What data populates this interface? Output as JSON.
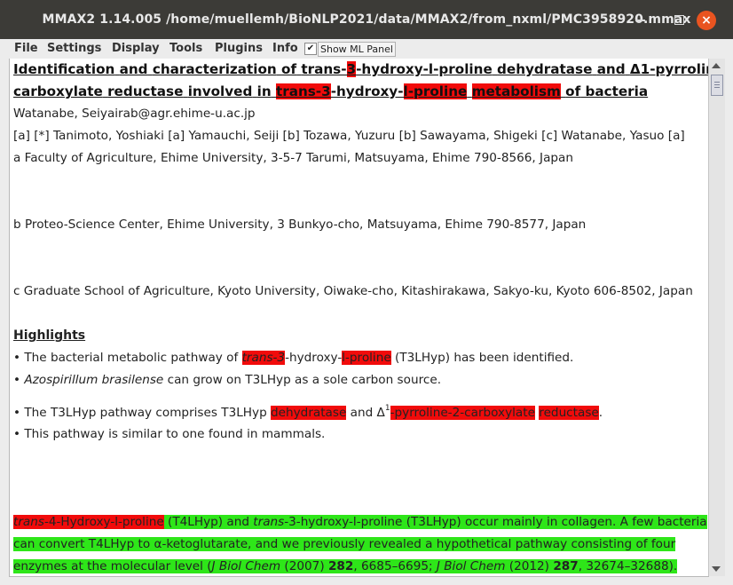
{
  "window": {
    "title": "MMAX2 1.14.005 /home/muellemh/BioNLP2021/data/MMAX2/from_nxml/PMC3958920.mmax",
    "close_label": "×"
  },
  "menubar": {
    "items": [
      "File",
      "Settings",
      "Display",
      "Tools",
      "Plugins",
      "Info"
    ],
    "ml_checkbox_mark": "✔",
    "ml_label": "Show ML Panel"
  },
  "doc": {
    "title_line1": [
      "Identification",
      "and",
      "characterization",
      "of",
      "trans-3-hydroxy-l-proline",
      "dehydratase",
      "and",
      "Δ1-pyrroline-2-"
    ],
    "title_line2": [
      "carboxylate",
      "reductase",
      "involved",
      "in",
      "trans-3-hydroxy-l-proline",
      "metabolism",
      "of",
      "bacteria"
    ],
    "t2_trans3": "trans-3",
    "t2_hydroxy": "-hydroxy-",
    "t2_lproline": "l-proline",
    "t2_metabolism": "metabolism",
    "t1_trans": "trans-",
    "t1_3": "3",
    "t1_rest": "-hydroxy-l-proline",
    "author_email": "Watanabe, Seiyairab@agr.ehime-u.ac.jp",
    "authors": "[a]  [*] Tanimoto, Yoshiaki [a] Yamauchi, Seiji [b] Tozawa, Yuzuru [b] Sawayama, Shigeki [c] Watanabe, Yasuo [a]",
    "affil_a": "a  Faculty of Agriculture, Ehime University, 3-5-7 Tarumi, Matsuyama, Ehime 790-8566, Japan",
    "affil_b": "b  Proteo-Science Center, Ehime University, 3 Bunkyo-cho, Matsuyama, Ehime 790-8577, Japan",
    "affil_c": "c  Graduate School of Agriculture, Kyoto University, Oiwake-cho, Kitashirakawa, Sakyo-ku, Kyoto 606-8502, Japan",
    "highlights_heading": "Highlights",
    "h1": {
      "pre": "• The bacterial metabolic pathway of ",
      "trans": "trans-3",
      "hyd": "-hydroxy-",
      "lpro": "l-proline",
      "post": " (T3LHyp) has been identified."
    },
    "h2": {
      "bullet": "• ",
      "italic": "Azospirillum brasilense",
      "post": " can grow on T3LHyp as a sole carbon source."
    },
    "h3": {
      "pre": "• The T3LHyp pathway comprises T3LHyp ",
      "dehyd": "dehydratase",
      "and": " and Δ",
      "sup": "1",
      "pyrr": "-pyrroline-2-carboxylate",
      "sp": " ",
      "red": "reductase",
      "end": "."
    },
    "h4": "• This pathway is similar to one found in mammals.",
    "abs_line1": {
      "it1": "trans",
      "a": "-4-Hydroxy-l-proline",
      "b": " (T4LHyp) and ",
      "it2": "trans",
      "c": "-3-hydroxy-l-proline (T3LHyp) occur mainly in collagen. A few bacteria"
    },
    "abs_line2": "can convert T4LHyp to α-ketoglutarate, and we previously revealed a hypothetical pathway consisting of four",
    "abs_line3": {
      "a": "enzymes at the molecular level (",
      "it1": "J Biol Chem",
      "b": " (2007) ",
      "b1": "282",
      "c": ", 6685–6695; ",
      "it2": "J Biol Chem",
      "d": " (2012) ",
      "b2": "287",
      "e": ", 32674–32688)."
    }
  }
}
